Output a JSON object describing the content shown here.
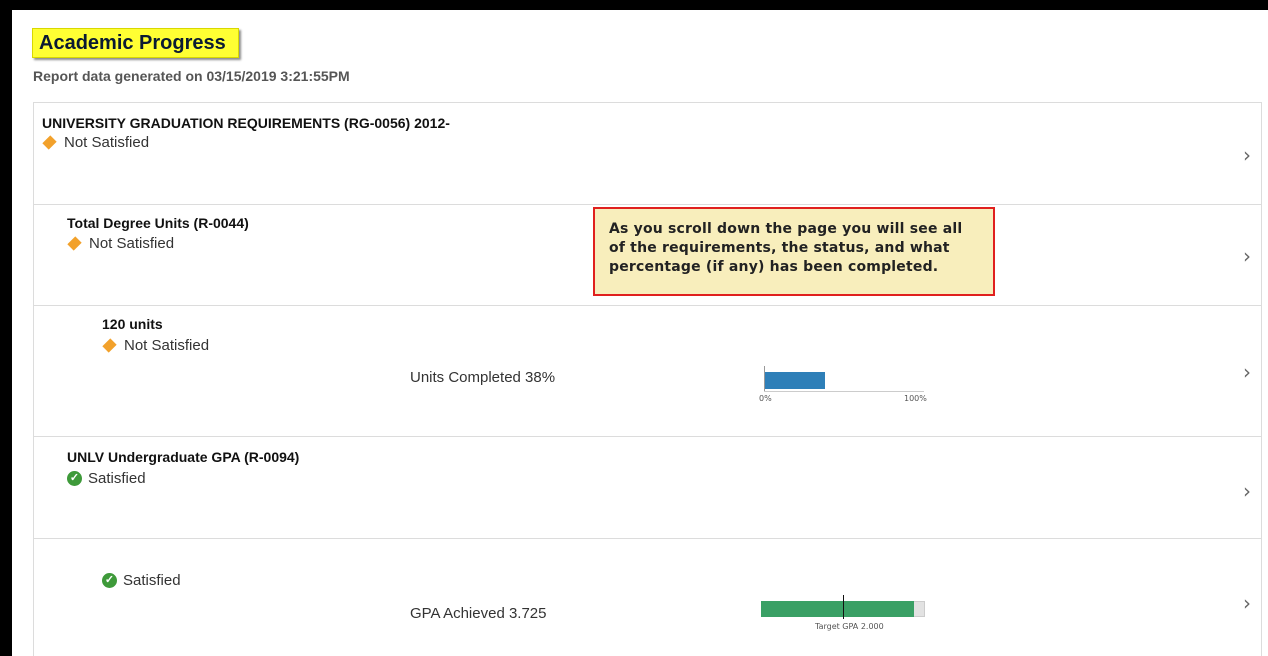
{
  "header": {
    "title": "Academic Progress",
    "generated": "Report data generated on 03/15/2019 3:21:55PM"
  },
  "rows": [
    {
      "title": "UNIVERSITY GRADUATION REQUIREMENTS (RG-0056) 2012-",
      "status": "Not Satisfied",
      "status_icon": "diamond-icon"
    },
    {
      "title": "Total Degree Units (R-0044)",
      "status": "Not Satisfied",
      "status_icon": "diamond-icon"
    },
    {
      "title": "120 units",
      "status": "Not Satisfied",
      "status_icon": "diamond-icon",
      "metric": {
        "label": "Units Completed 38%",
        "percent": 38,
        "axis_min": "0%",
        "axis_max": "100%"
      }
    },
    {
      "title": "UNLV Undergraduate GPA (R-0094)",
      "status": "Satisfied",
      "status_icon": "check-icon"
    },
    {
      "title": "",
      "status": "Satisfied",
      "status_icon": "check-icon",
      "metric": {
        "label": "GPA Achieved  3.725",
        "value": 3.725,
        "max": 4.0,
        "target": 2.0,
        "target_label": "Target GPA 2.000"
      }
    }
  ],
  "callout": {
    "text": "As you scroll down the page you will see all of the requirements, the status, and what percentage (if any) has been completed."
  },
  "colors": {
    "highlight": "#ffff33",
    "not_satisfied": "#f2a12b",
    "satisfied": "#3e9a3a",
    "units_bar": "#2e7fb8",
    "gpa_bar": "#3aa065",
    "callout_bg": "#f8eebc",
    "callout_border": "#e0201e"
  },
  "icons": {
    "chevron": "chevron-right-icon",
    "check_glyph": "✓"
  }
}
